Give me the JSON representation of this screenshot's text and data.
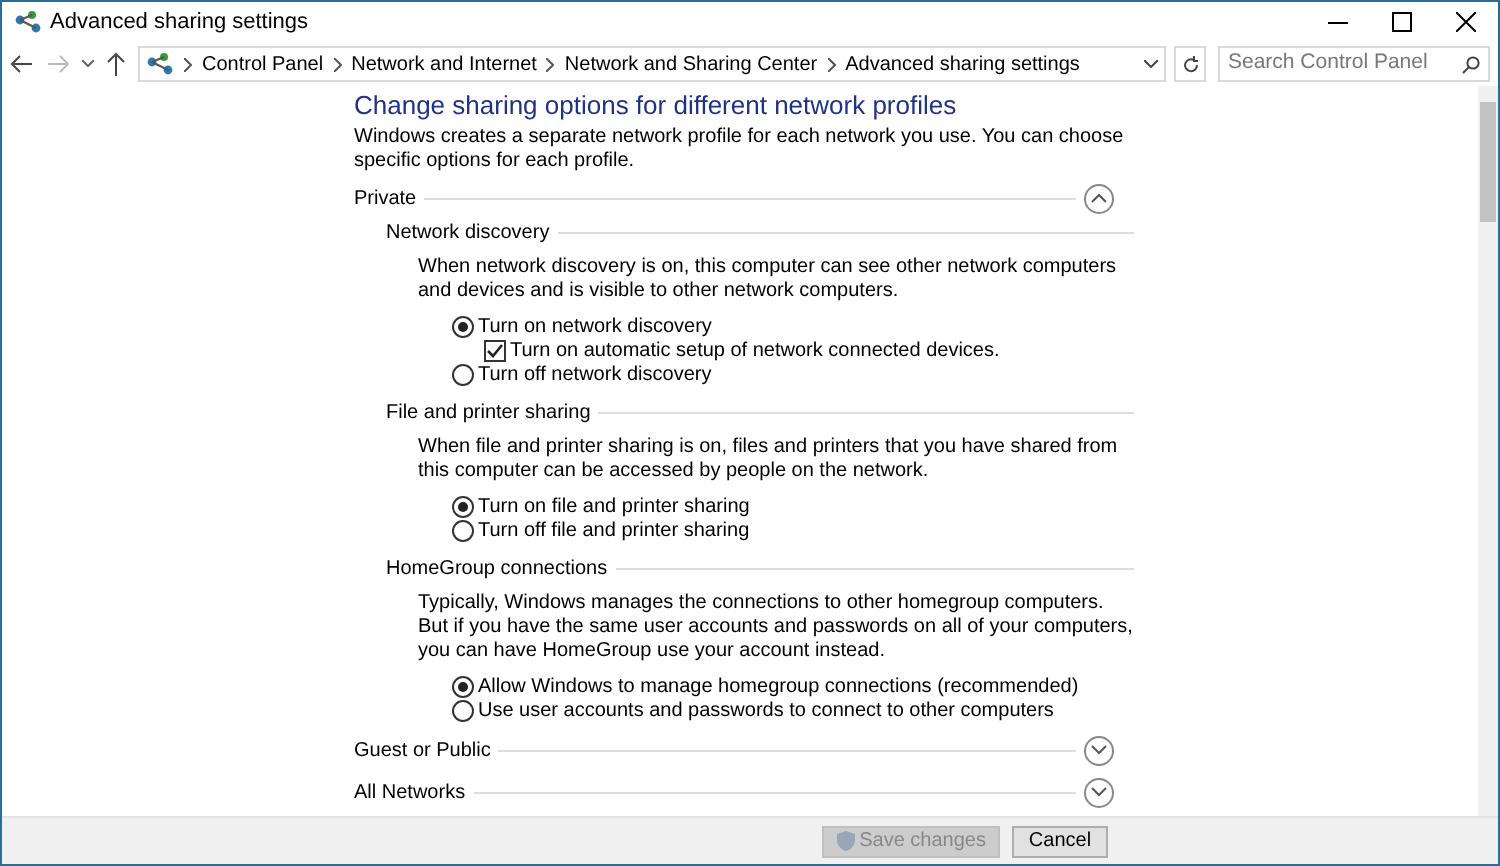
{
  "window": {
    "title": "Advanced sharing settings"
  },
  "address_bar": {
    "breadcrumbs": [
      "Control Panel",
      "Network and Internet",
      "Network and Sharing Center",
      "Advanced sharing settings"
    ],
    "search": {
      "placeholder": "Search Control Panel"
    }
  },
  "heading": "Change sharing options for different network profiles",
  "intro": "Windows creates a separate network profile for each network you use. You can choose specific options for each profile.",
  "profiles": [
    {
      "name": "Private",
      "expanded": true,
      "sections": [
        {
          "title": "Network discovery",
          "description": "When network discovery is on, this computer can see other network computers and devices and is visible to other network computers.",
          "options": [
            {
              "label": "Turn on network discovery",
              "selected": true,
              "children": [
                {
                  "label": "Turn on automatic setup of network connected devices.",
                  "checked": true
                }
              ]
            },
            {
              "label": "Turn off network discovery",
              "selected": false
            }
          ]
        },
        {
          "title": "File and printer sharing",
          "description": "When file and printer sharing is on, files and printers that you have shared from this computer can be accessed by people on the network.",
          "options": [
            {
              "label": "Turn on file and printer sharing",
              "selected": true
            },
            {
              "label": "Turn off file and printer sharing",
              "selected": false
            }
          ]
        },
        {
          "title": "HomeGroup connections",
          "description": "Typically, Windows manages the connections to other homegroup computers. But if you have the same user accounts and passwords on all of your computers, you can have HomeGroup use your account instead.",
          "options": [
            {
              "label": "Allow Windows to manage homegroup connections (recommended)",
              "selected": true
            },
            {
              "label": "Use user accounts and passwords to connect to other computers",
              "selected": false
            }
          ]
        }
      ]
    },
    {
      "name": "Guest or Public",
      "expanded": false
    },
    {
      "name": "All Networks",
      "expanded": false
    }
  ],
  "footer": {
    "buttons": [
      {
        "label": "Save changes",
        "kind": "shield",
        "disabled": true
      },
      {
        "label": "Cancel",
        "kind": "plain",
        "disabled": false
      }
    ]
  }
}
